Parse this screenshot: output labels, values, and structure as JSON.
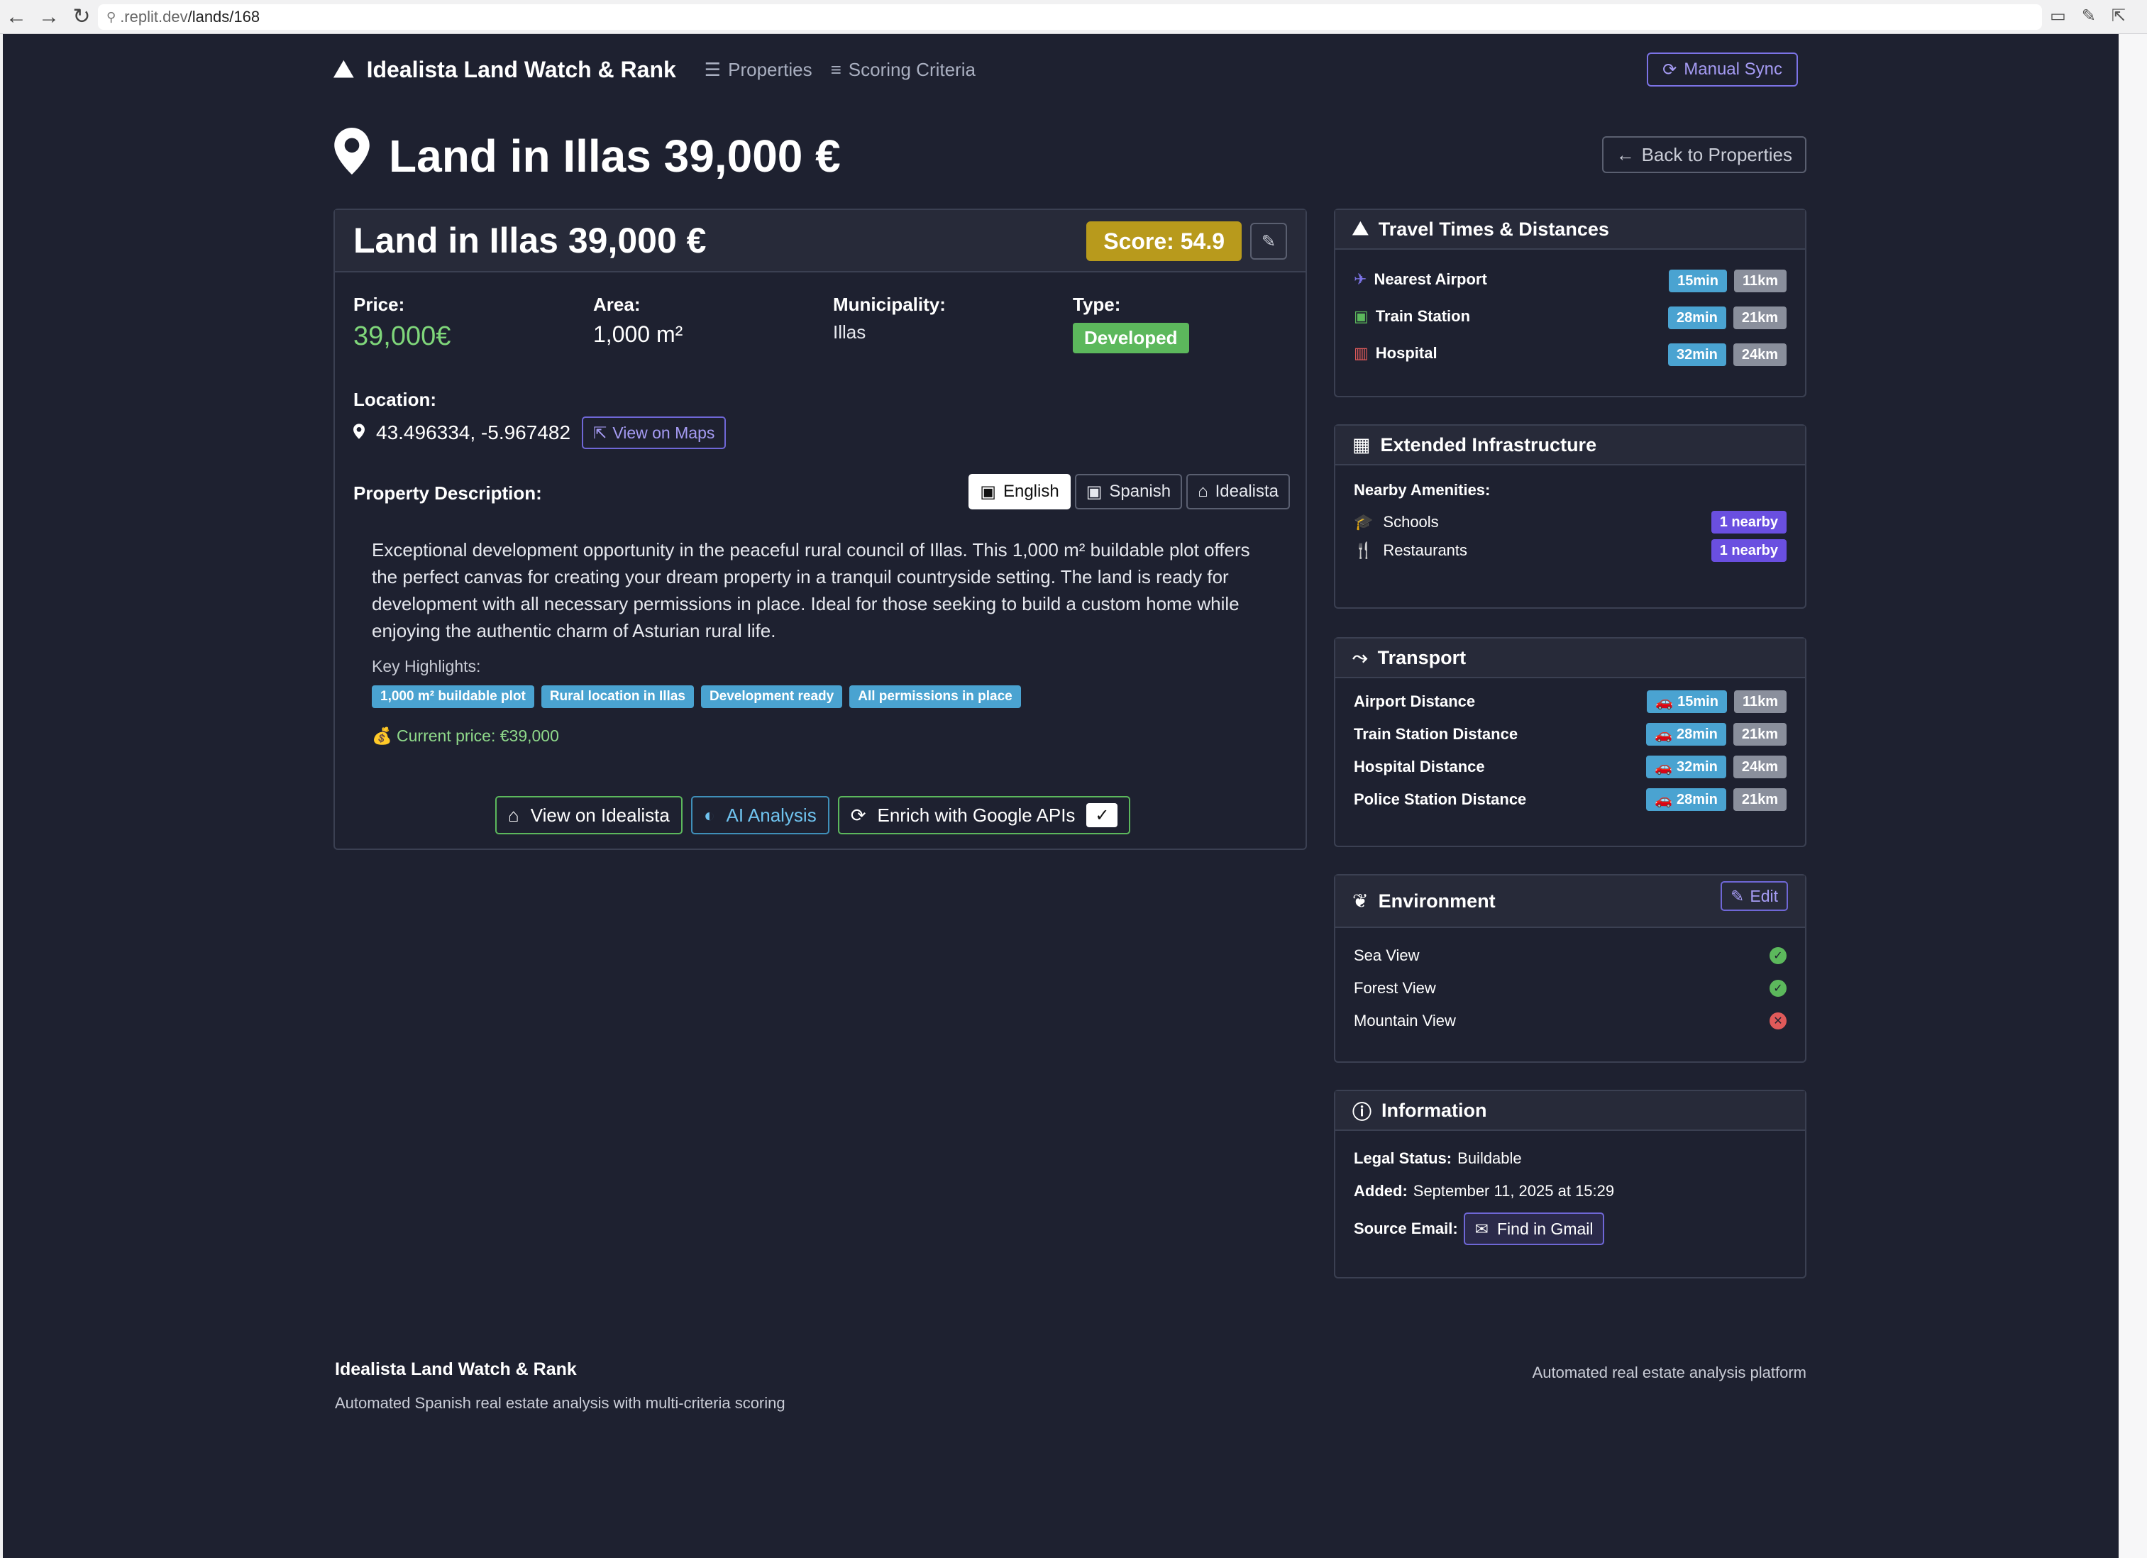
{
  "browser": {
    "url_host": ".replit.dev",
    "url_path": "/lands/168"
  },
  "nav": {
    "brand": "Idealista Land Watch & Rank",
    "links": [
      "Properties",
      "Scoring Criteria"
    ],
    "manual_sync": "Manual Sync"
  },
  "page": {
    "title": "Land in Illas 39,000 €",
    "back_label": "Back to Properties"
  },
  "property": {
    "title": "Land in Illas 39,000 €",
    "score": "Score: 54.9",
    "price_label": "Price:",
    "price": "39,000€",
    "area_label": "Area:",
    "area": "1,000 m²",
    "municipality_label": "Municipality:",
    "municipality": "Illas",
    "type_label": "Type:",
    "type": "Developed",
    "location_label": "Location:",
    "coordinates": "43.496334, -5.967482",
    "view_on_maps": "View on Maps",
    "description_label": "Property Description:",
    "lang_tabs": [
      "English",
      "Spanish",
      "Idealista"
    ],
    "description": "Exceptional development opportunity in the peaceful rural council of Illas. This 1,000 m² buildable plot offers the perfect canvas for creating your dream property in a tranquil countryside setting. The land is ready for development with all necessary permissions in place. Ideal for those seeking to build a custom home while enjoying the authentic charm of Asturian rural life.",
    "key_highlights_label": "Key Highlights:",
    "highlights": [
      "1,000 m² buildable plot",
      "Rural location in Illas",
      "Development ready",
      "All permissions in place"
    ],
    "current_price": "Current price: €39,000",
    "actions": {
      "view_idealista": "View on Idealista",
      "ai_analysis": "AI Analysis",
      "enrich": "Enrich with Google APIs",
      "enrich_check": "✓"
    }
  },
  "travel": {
    "title": "Travel Times & Distances",
    "rows": [
      {
        "label": "Nearest Airport",
        "time": "15min",
        "dist": "11km"
      },
      {
        "label": "Train Station",
        "time": "28min",
        "dist": "21km"
      },
      {
        "label": "Hospital",
        "time": "32min",
        "dist": "24km"
      }
    ]
  },
  "infrastructure": {
    "title": "Extended Infrastructure",
    "subtitle": "Nearby Amenities:",
    "rows": [
      {
        "label": "Schools",
        "count": "1 nearby"
      },
      {
        "label": "Restaurants",
        "count": "1 nearby"
      }
    ]
  },
  "transport": {
    "title": "Transport",
    "rows": [
      {
        "label": "Airport Distance",
        "time": "15min",
        "dist": "11km"
      },
      {
        "label": "Train Station Distance",
        "time": "28min",
        "dist": "21km"
      },
      {
        "label": "Hospital Distance",
        "time": "32min",
        "dist": "24km"
      },
      {
        "label": "Police Station Distance",
        "time": "28min",
        "dist": "21km"
      }
    ]
  },
  "environment": {
    "title": "Environment",
    "edit_label": "Edit",
    "rows": [
      {
        "label": "Sea View",
        "value": true
      },
      {
        "label": "Forest View",
        "value": true
      },
      {
        "label": "Mountain View",
        "value": false
      }
    ]
  },
  "information": {
    "title": "Information",
    "legal_label": "Legal Status:",
    "legal_value": "Buildable",
    "added_label": "Added:",
    "added_value": "September 11, 2025 at 15:29",
    "source_label": "Source Email:",
    "gmail_button": "Find in Gmail"
  },
  "footer": {
    "title": "Idealista Land Watch & Rank",
    "subtitle": "Automated Spanish real estate analysis with multi-criteria scoring",
    "right": "Automated real estate analysis platform"
  },
  "colors": {
    "background": "#1e2130",
    "score": "#b89a1c",
    "developed": "#5cb85c",
    "time_pill": "#4aa3d1",
    "nearby_pill": "#6a4fe0"
  }
}
